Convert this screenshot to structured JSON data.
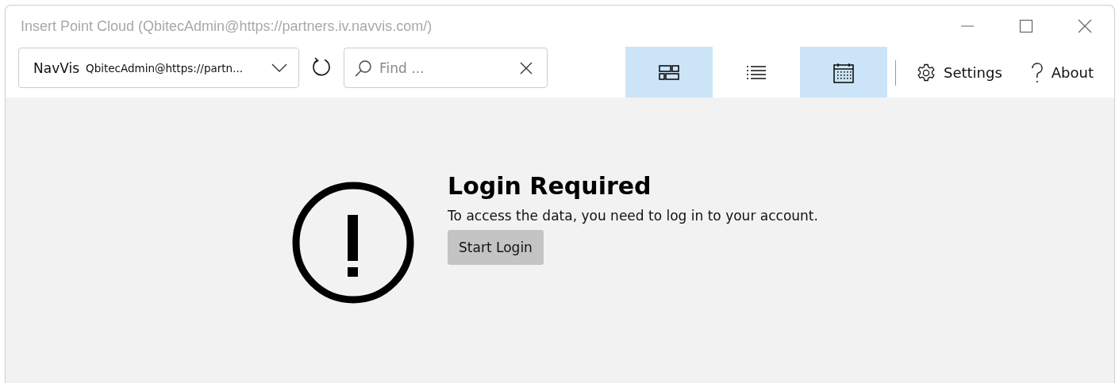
{
  "window": {
    "title": "Insert Point Cloud (QbitecAdmin@https://partners.iv.navvis.com/)"
  },
  "toolbar": {
    "account_dropdown": {
      "name": "NavVis",
      "account": "QbitecAdmin@https://partn..."
    },
    "search": {
      "placeholder": "Find ..."
    },
    "view_buttons": [
      {
        "kind": "tiles",
        "selected": true
      },
      {
        "kind": "list",
        "selected": false
      },
      {
        "kind": "calendar",
        "selected": true
      }
    ],
    "settings": "Settings",
    "about": "About"
  },
  "content": {
    "heading": "Login Required",
    "message": "To access the data, you need to log in to your account.",
    "button": "Start Login"
  }
}
